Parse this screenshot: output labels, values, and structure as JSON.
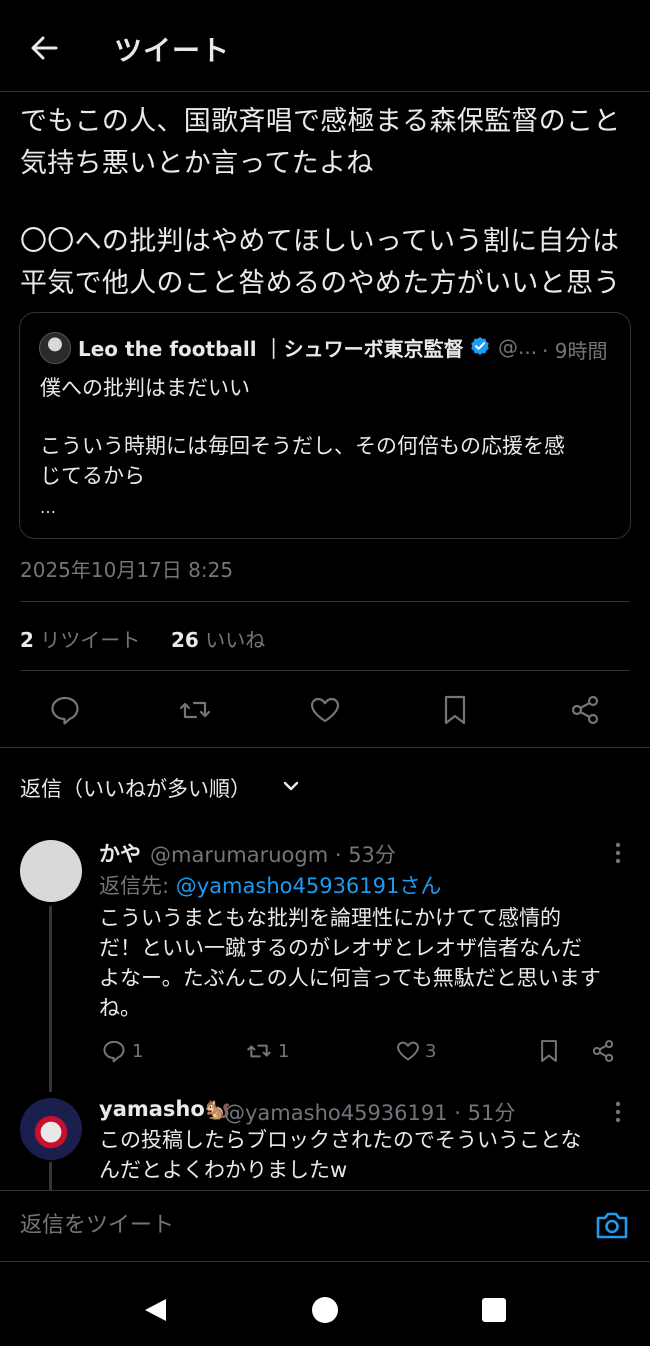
{
  "header": {
    "title": "ツイート"
  },
  "tweet": {
    "lines": [
      "でもこの人、国歌斉唱で感極まる森保監督のこと",
      "気持ち悪いとか言ってたよね",
      "〇〇への批判はやめてほしいっていう割に自分は",
      "平気で他人のこと咎めるのやめた方がいいと思う"
    ],
    "timestamp": "2025年10月17日 8:25",
    "retweet_count": "2",
    "retweet_label": "リツイート",
    "like_count": "26",
    "like_label": "いいね"
  },
  "quote": {
    "name": "Leo the football ｜シュワーボ東京監督",
    "handle": "@...",
    "time": "· 9時間",
    "lines": [
      "僕への批判はまだいい",
      "こういう時期には毎回そうだし、その何倍もの応援を感",
      "じてるから",
      "…"
    ]
  },
  "actions": [
    "reply-icon",
    "retweet-icon",
    "like-icon",
    "bookmark-icon",
    "share-icon"
  ],
  "replies_header": {
    "label": "返信（いいねが多い順）"
  },
  "replies": [
    {
      "name": "かや",
      "meta": "@marumaruogm · 53分",
      "reply_to_prefix": "返信先: ",
      "reply_to_handle": "@yamasho45936191さん",
      "lines": [
        "こういうまともな批判を論理性にかけてて感情的",
        "だ！といい一蹴するのがレオザとレオザ信者なんだ",
        "よなー。たぶんこの人に何言っても無駄だと思います",
        "ね。"
      ],
      "reply_count": "1",
      "retweet_count": "1",
      "like_count": "3"
    },
    {
      "name": "yamasho🐿️",
      "meta": "@yamasho45936191 · 51分",
      "lines": [
        "この投稿したらブロックされたのでそういうことな",
        "んだとよくわかりましたw"
      ]
    }
  ],
  "compose": {
    "placeholder": "返信をツイート"
  },
  "colors": {
    "background": "#000000",
    "text": "#e7e9ea",
    "muted": "#71767b",
    "accent": "#1d9bf0",
    "divider": "#2f3336"
  }
}
